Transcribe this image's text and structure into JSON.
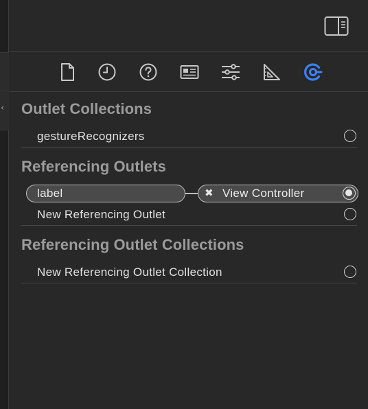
{
  "colors": {
    "accent": "#3c82f6",
    "icon": "#c8c8c8",
    "header_text": "#9b9b9b",
    "row_text": "#e2e2e2",
    "background": "#282828"
  },
  "toolbar": {
    "inspector_toggle_icon": "inspector-panel-icon"
  },
  "tabs": [
    {
      "name": "file-inspector",
      "icon": "document-icon"
    },
    {
      "name": "history-inspector",
      "icon": "clock-icon"
    },
    {
      "name": "quick-help",
      "icon": "question-icon"
    },
    {
      "name": "identity-inspector",
      "icon": "id-card-icon"
    },
    {
      "name": "attributes-inspector",
      "icon": "sliders-icon"
    },
    {
      "name": "size-inspector",
      "icon": "ruler-triangle-icon"
    },
    {
      "name": "connections-inspector",
      "icon": "connection-icon",
      "selected": true
    }
  ],
  "sections": {
    "outlet_collections": {
      "title": "Outlet Collections",
      "rows": [
        {
          "label": "gestureRecognizers"
        }
      ]
    },
    "referencing_outlets": {
      "title": "Referencing Outlets",
      "connection": {
        "outlet": "label",
        "target": "View Controller",
        "remove_glyph": "✖"
      },
      "new_row": {
        "label": "New Referencing Outlet"
      }
    },
    "referencing_outlet_collections": {
      "title": "Referencing Outlet Collections",
      "new_row": {
        "label": "New Referencing Outlet Collection"
      }
    }
  }
}
